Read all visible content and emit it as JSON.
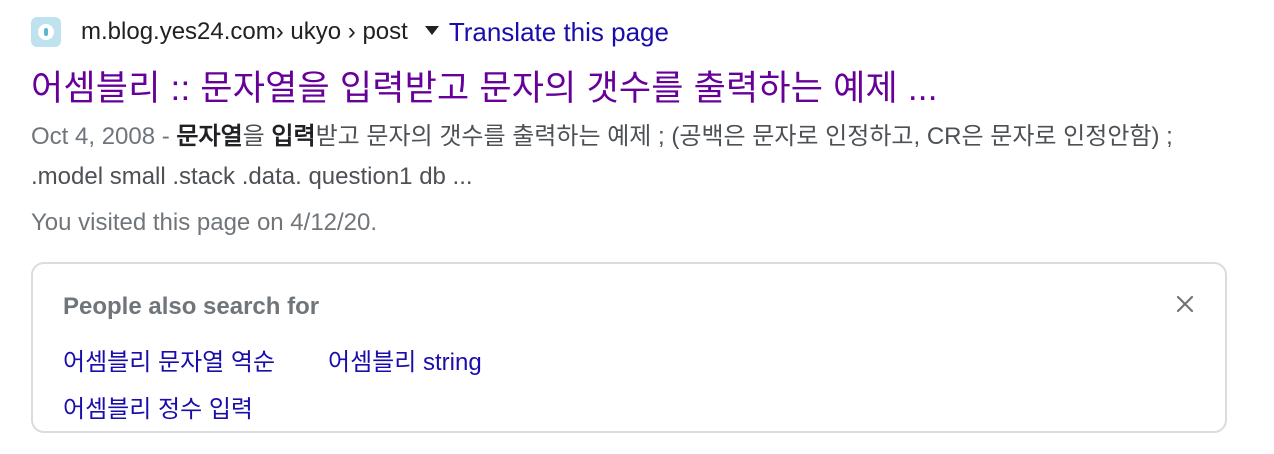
{
  "breadcrumb": {
    "favicon": "yes24-blog-favicon",
    "domain": "m.blog.yes24.com",
    "path": " › ukyo › post",
    "translate_label": "Translate this page"
  },
  "result": {
    "title": "어셈블리 :: 문자열을 입력받고 문자의 갯수를 출력하는 예제 ...",
    "snippet": {
      "date": "Oct 4, 2008",
      "separator": " - ",
      "bold1": "문자열",
      "text1": "을 ",
      "bold2": "입력",
      "text2": "받고 문자의 갯수를 출력하는 예제 ; (공백은 문자로 인정하고, CR은 문자로 인정안함) ; .model small .stack .data. question1 db ..."
    },
    "visited": "You visited this page on 4/12/20."
  },
  "people_also_search": {
    "title": "People also search for",
    "items": [
      {
        "label": "어셈블리 문자열 역순"
      },
      {
        "label": "어셈블리 string"
      },
      {
        "label": "어셈블리 정수 입력"
      }
    ]
  },
  "colors": {
    "link": "#1a0dab",
    "visited_title": "#660099",
    "muted": "#70757a",
    "text": "#4d5156"
  },
  "icons": {
    "dropdown": "caret-down-icon",
    "close": "close-icon"
  }
}
